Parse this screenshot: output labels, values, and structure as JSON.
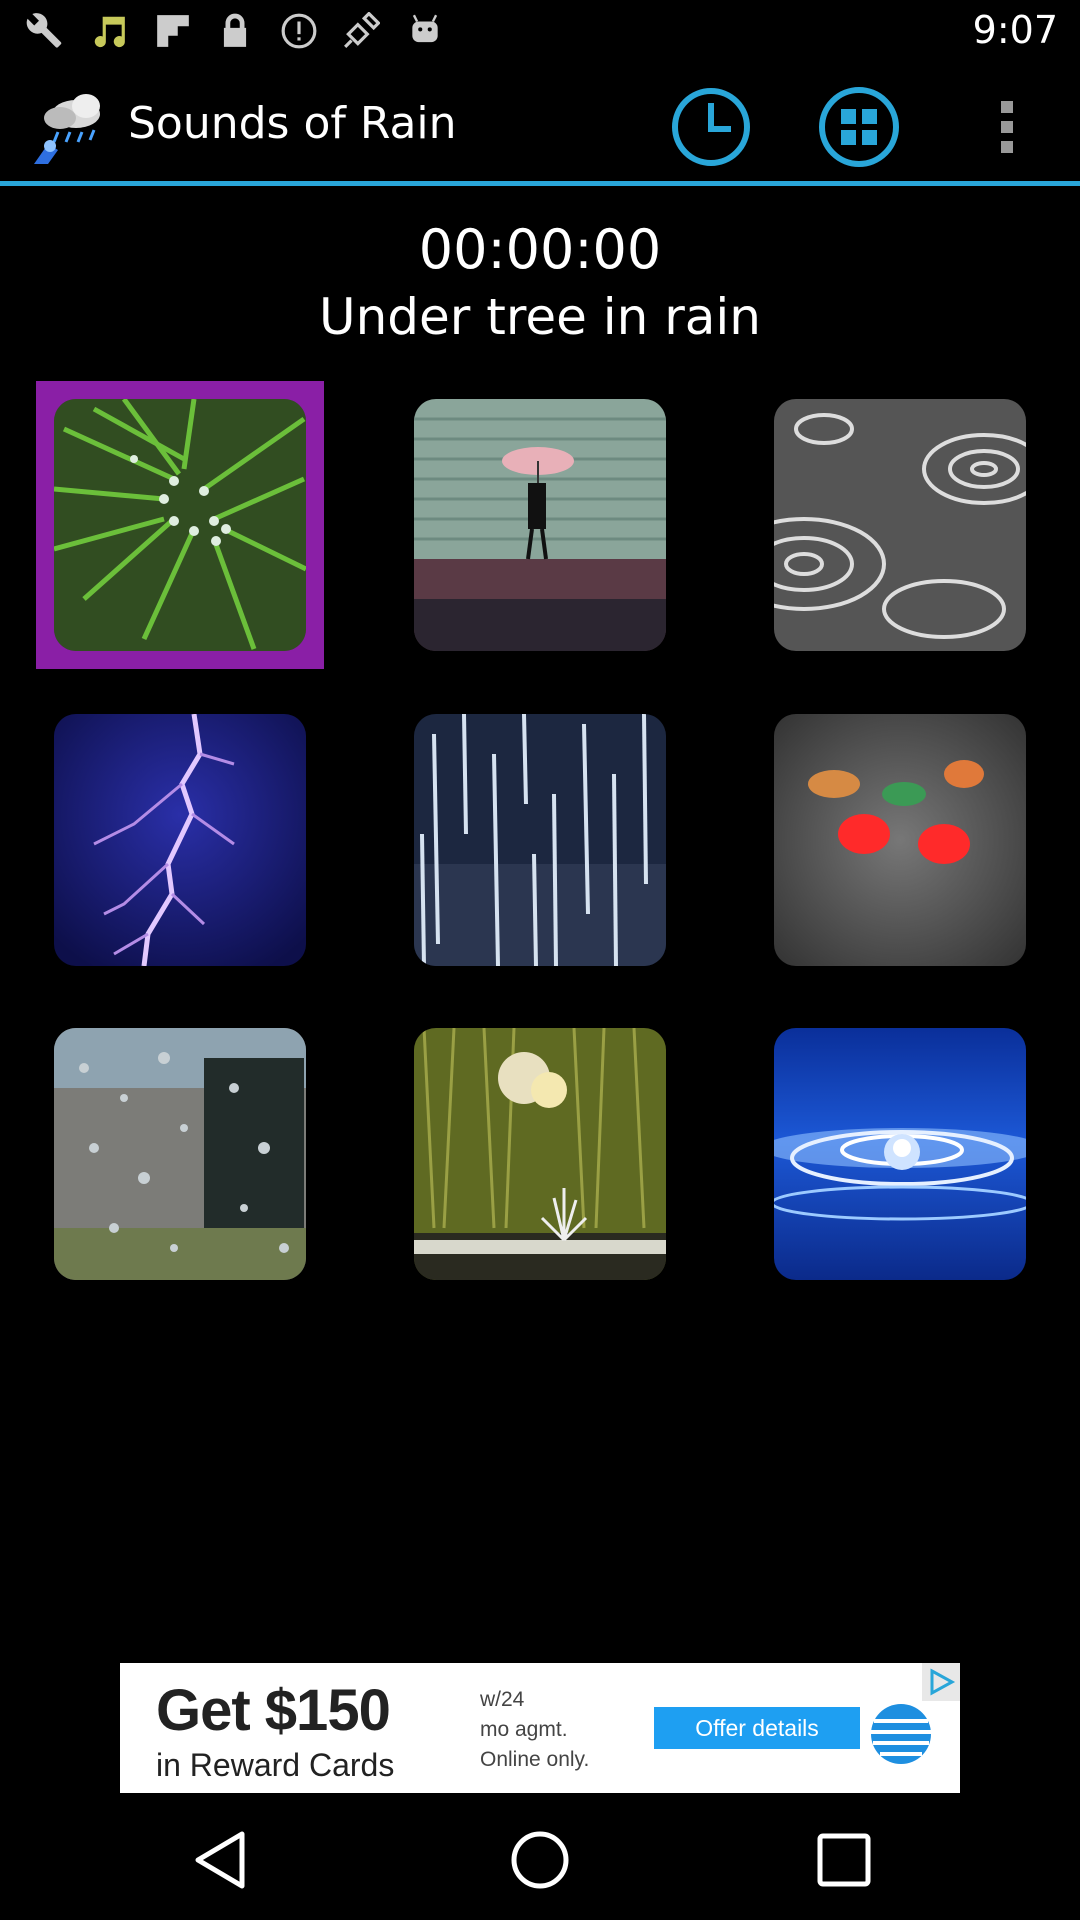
{
  "status_bar": {
    "time": "9:07",
    "icons": [
      "wrench-icon",
      "music-note-icon",
      "flipboard-icon",
      "lock-icon",
      "info-circle-icon",
      "satellite-icon",
      "android-icon"
    ]
  },
  "app_bar": {
    "title": "Sounds of Rain",
    "logo": "rain-cloud-logo",
    "actions": [
      "clock-icon",
      "grid-icon",
      "overflow-menu-icon"
    ],
    "accent_color": "#29a6d9"
  },
  "player": {
    "timer": "00:00:00",
    "current_sound": "Under tree in rain"
  },
  "sounds_grid": {
    "selected_index": 0,
    "selection_color": "#8a1fa6",
    "tiles": [
      {
        "name": "pine-needles-rain-tile"
      },
      {
        "name": "umbrella-walk-tile"
      },
      {
        "name": "puddle-ripples-tile"
      },
      {
        "name": "lightning-tile"
      },
      {
        "name": "heavy-rain-tile"
      },
      {
        "name": "wet-window-lights-tile"
      },
      {
        "name": "raindrops-glass-tile"
      },
      {
        "name": "rain-on-grass-tile"
      },
      {
        "name": "water-drop-tile"
      }
    ]
  },
  "ad": {
    "headline": "Get $150",
    "subline": "in Reward Cards",
    "terms": "w/24\nmo agmt.\nOnline only.",
    "cta": "Offer details",
    "brand_logo": "att-globe-logo"
  },
  "nav_bar": {
    "buttons": [
      "back-icon",
      "home-icon",
      "recents-icon"
    ]
  }
}
